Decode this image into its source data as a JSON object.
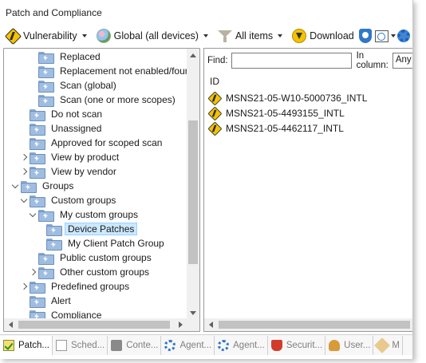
{
  "window": {
    "title": "Patch and Compliance"
  },
  "toolbar": {
    "vulnerability_label": "Vulnerability",
    "scope_label": "Global (all devices)",
    "filter_label": "All items",
    "download_label": "Download"
  },
  "tree": {
    "items": [
      {
        "label": "Replaced",
        "level": 4,
        "expand": "none",
        "selected": false
      },
      {
        "label": "Replacement not enabled/found",
        "level": 4,
        "expand": "none",
        "selected": false
      },
      {
        "label": "Scan (global)",
        "level": 4,
        "expand": "none",
        "selected": false
      },
      {
        "label": "Scan (one or more scopes)",
        "level": 4,
        "expand": "none",
        "selected": false
      },
      {
        "label": "Do not scan",
        "level": 3,
        "expand": "none",
        "selected": false
      },
      {
        "label": "Unassigned",
        "level": 3,
        "expand": "none",
        "selected": false
      },
      {
        "label": "Approved for scoped scan",
        "level": 3,
        "expand": "none",
        "selected": false
      },
      {
        "label": "View by product",
        "level": 3,
        "expand": "collapsed",
        "selected": false
      },
      {
        "label": "View by vendor",
        "level": 3,
        "expand": "collapsed",
        "selected": false
      },
      {
        "label": "Groups",
        "level": 2,
        "expand": "expanded",
        "selected": false
      },
      {
        "label": "Custom groups",
        "level": 3,
        "expand": "expanded",
        "selected": false
      },
      {
        "label": "My custom groups",
        "level": 4,
        "expand": "expanded",
        "selected": false
      },
      {
        "label": "Device Patches",
        "level": 5,
        "expand": "none",
        "selected": true
      },
      {
        "label": "My Client Patch Group",
        "level": 5,
        "expand": "none",
        "selected": false
      },
      {
        "label": "Public custom groups",
        "level": 4,
        "expand": "none",
        "selected": false
      },
      {
        "label": "Other custom groups",
        "level": 4,
        "expand": "collapsed",
        "selected": false
      },
      {
        "label": "Predefined groups",
        "level": 3,
        "expand": "collapsed",
        "selected": false
      },
      {
        "label": "Alert",
        "level": 3,
        "expand": "none",
        "selected": false
      },
      {
        "label": "Compliance",
        "level": 3,
        "expand": "none",
        "selected": false
      }
    ]
  },
  "find": {
    "label": "Find:",
    "value": "",
    "in_column_label": "In column:",
    "column_value": "Any"
  },
  "list": {
    "column_header": "ID",
    "rows": [
      "MSNS21-05-W10-5000736_INTL",
      "MSNS21-05-4493155_INTL",
      "MSNS21-05-4462117_INTL"
    ]
  },
  "tabs": [
    {
      "label": "Patch...",
      "icon": "patch-icon",
      "active": true
    },
    {
      "label": "Sched...",
      "icon": "scheduled-tasks-icon",
      "active": false
    },
    {
      "label": "Conte...",
      "icon": "content-icon",
      "active": false
    },
    {
      "label": "Agent...",
      "icon": "agent-settings-icon",
      "active": false
    },
    {
      "label": "Agent...",
      "icon": "agent-gear-icon",
      "active": false
    },
    {
      "label": "Securit...",
      "icon": "security-icon",
      "active": false
    },
    {
      "label": "User...",
      "icon": "user-icon",
      "active": false
    },
    {
      "label": "M",
      "icon": "m-icon",
      "active": false
    }
  ]
}
